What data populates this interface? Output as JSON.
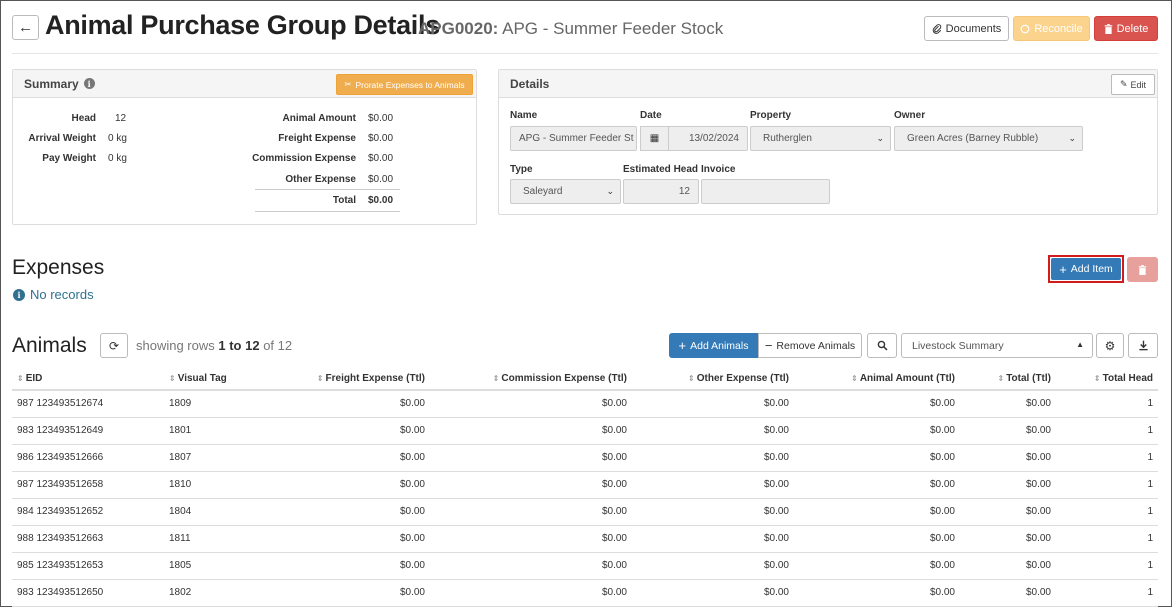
{
  "header": {
    "title": "Animal Purchase Group Details",
    "code": "APG0020:",
    "name": "APG - Summer Feeder Stock",
    "documents_label": "Documents",
    "reconcile_label": "Reconcile",
    "delete_label": "Delete"
  },
  "summary": {
    "title": "Summary",
    "prorate_label": "Prorate Expenses to Animals",
    "left": [
      {
        "label": "Head",
        "value": "12"
      },
      {
        "label": "Arrival Weight",
        "value": "0 kg"
      },
      {
        "label": "Pay Weight",
        "value": "0 kg"
      }
    ],
    "right": [
      {
        "label": "Animal Amount",
        "value": "$0.00"
      },
      {
        "label": "Freight Expense",
        "value": "$0.00"
      },
      {
        "label": "Commission Expense",
        "value": "$0.00"
      },
      {
        "label": "Other Expense",
        "value": "$0.00"
      },
      {
        "label": "Total",
        "value": "$0.00"
      }
    ]
  },
  "details": {
    "title": "Details",
    "edit_label": "Edit",
    "name_label": "Name",
    "name_value": "APG - Summer Feeder St",
    "date_label": "Date",
    "date_value": "13/02/2024",
    "property_label": "Property",
    "property_value": "Rutherglen",
    "owner_label": "Owner",
    "owner_value": "Green Acres (Barney Rubble)",
    "type_label": "Type",
    "type_value": "Saleyard",
    "est_head_label": "Estimated Head",
    "est_head_value": "12",
    "invoice_label": "Invoice",
    "invoice_value": ""
  },
  "expenses": {
    "title": "Expenses",
    "empty_text": "No records",
    "add_item_label": "Add Item"
  },
  "animals": {
    "title": "Animals",
    "showing_prefix": "showing rows",
    "range": "1 to 12",
    "of_text": "of",
    "total": "12",
    "add_label": "Add Animals",
    "remove_label": "Remove Animals",
    "view_value": "Livestock Summary",
    "columns": [
      "EID",
      "Visual Tag",
      "Freight Expense (Ttl)",
      "Commission Expense (Ttl)",
      "Other Expense (Ttl)",
      "Animal Amount (Ttl)",
      "Total (Ttl)",
      "Total Head"
    ],
    "rows": [
      [
        "987 123493512674",
        "1809",
        "$0.00",
        "$0.00",
        "$0.00",
        "$0.00",
        "$0.00",
        "1"
      ],
      [
        "983 123493512649",
        "1801",
        "$0.00",
        "$0.00",
        "$0.00",
        "$0.00",
        "$0.00",
        "1"
      ],
      [
        "986 123493512666",
        "1807",
        "$0.00",
        "$0.00",
        "$0.00",
        "$0.00",
        "$0.00",
        "1"
      ],
      [
        "987 123493512658",
        "1810",
        "$0.00",
        "$0.00",
        "$0.00",
        "$0.00",
        "$0.00",
        "1"
      ],
      [
        "984 123493512652",
        "1804",
        "$0.00",
        "$0.00",
        "$0.00",
        "$0.00",
        "$0.00",
        "1"
      ],
      [
        "988 123493512663",
        "1811",
        "$0.00",
        "$0.00",
        "$0.00",
        "$0.00",
        "$0.00",
        "1"
      ],
      [
        "985 123493512653",
        "1805",
        "$0.00",
        "$0.00",
        "$0.00",
        "$0.00",
        "$0.00",
        "1"
      ],
      [
        "983 123493512650",
        "1802",
        "$0.00",
        "$0.00",
        "$0.00",
        "$0.00",
        "$0.00",
        "1"
      ]
    ]
  }
}
